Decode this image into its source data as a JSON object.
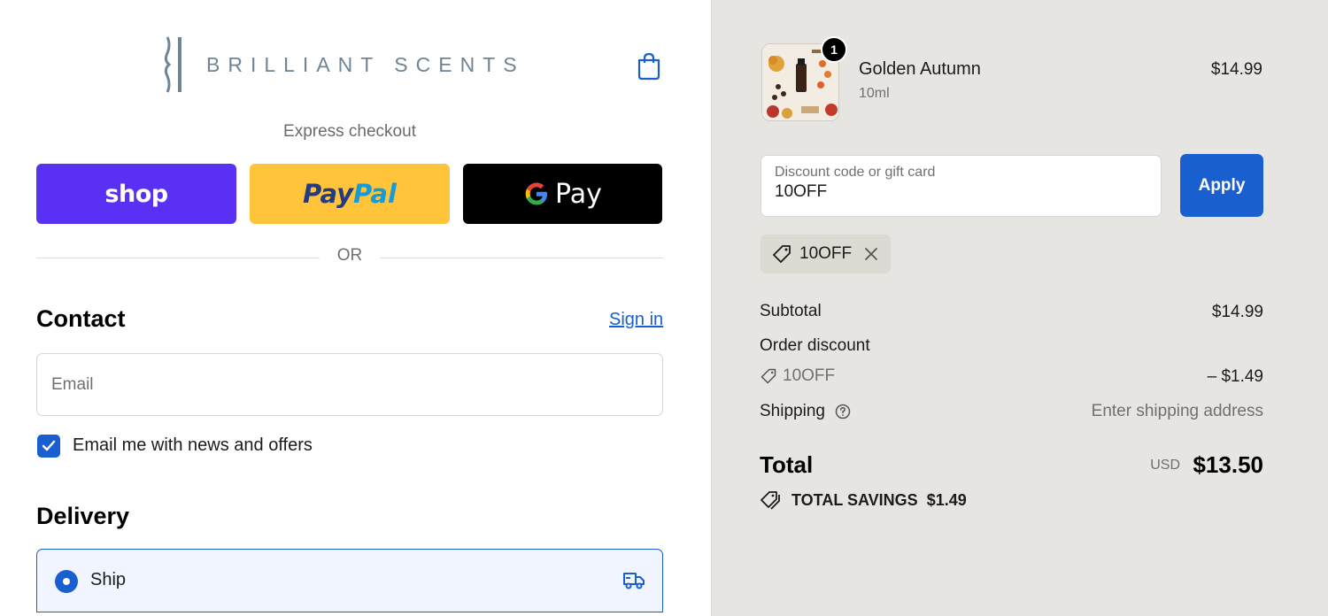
{
  "brand": {
    "name": "BRILLIANT SCENTS"
  },
  "express": {
    "title": "Express checkout",
    "shop_label": "shop",
    "paypal_label_1": "Pay",
    "paypal_label_2": "Pal",
    "gpay_label": "Pay",
    "or": "OR"
  },
  "contact": {
    "title": "Contact",
    "signin": "Sign in",
    "email_placeholder": "Email",
    "newsletter_label": "Email me with news and offers",
    "newsletter_checked": true
  },
  "delivery": {
    "title": "Delivery",
    "option_ship": "Ship"
  },
  "cart": {
    "quantity": "1",
    "product_name": "Golden Autumn",
    "variant": "10ml",
    "price": "$14.99"
  },
  "discount": {
    "placeholder": "Discount code or gift card",
    "value": "10OFF",
    "apply_label": "Apply",
    "applied_code": "10OFF"
  },
  "summary": {
    "subtotal_label": "Subtotal",
    "subtotal_value": "$14.99",
    "order_discount_label": "Order discount",
    "discount_code": "10OFF",
    "discount_value": "– $1.49",
    "shipping_label": "Shipping",
    "shipping_value": "Enter shipping address",
    "total_label": "Total",
    "currency": "USD",
    "total_value": "$13.50",
    "savings_label": "TOTAL SAVINGS",
    "savings_value": "$1.49"
  },
  "colors": {
    "accent": "#1a5fd0",
    "shop_purple": "#5a31f4",
    "paypal_yellow": "#ffc439",
    "summary_bg": "#e7e5e1"
  }
}
